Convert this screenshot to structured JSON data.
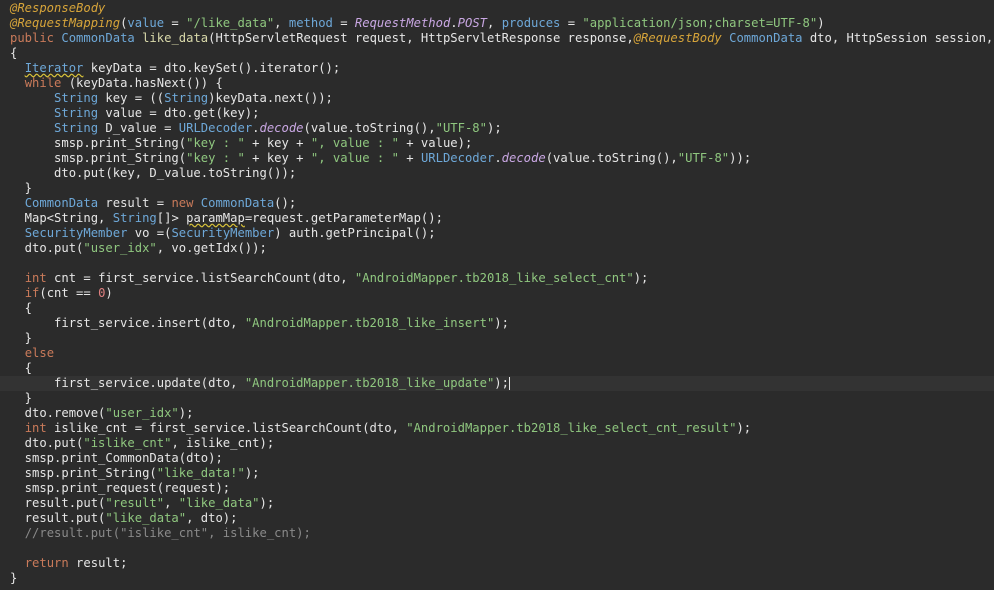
{
  "editor": {
    "lines": [
      [
        [
          "t-ann",
          "@ResponseBody"
        ]
      ],
      [
        [
          "t-ann",
          "@RequestMapping"
        ],
        [
          "t-text",
          "("
        ],
        [
          "t-type",
          "value"
        ],
        [
          "t-text",
          " = "
        ],
        [
          "t-str",
          "\"/like_data\""
        ],
        [
          "t-text",
          ", "
        ],
        [
          "t-type",
          "method"
        ],
        [
          "t-text",
          " = "
        ],
        [
          "t-italic",
          "RequestMethod"
        ],
        [
          "t-text",
          "."
        ],
        [
          "t-italic",
          "POST"
        ],
        [
          "t-text",
          ", "
        ],
        [
          "t-type",
          "produces"
        ],
        [
          "t-text",
          " = "
        ],
        [
          "t-str",
          "\"application/json;charset=UTF-8\""
        ],
        [
          "t-text",
          ")"
        ]
      ],
      [
        [
          "t-kw",
          "public"
        ],
        [
          "t-text",
          " "
        ],
        [
          "t-type",
          "CommonData"
        ],
        [
          "t-text",
          " "
        ],
        [
          "t-method",
          "like_data"
        ],
        [
          "t-text",
          "(HttpServletRequest request, HttpServletResponse response,"
        ],
        [
          "t-ann",
          "@RequestBody"
        ],
        [
          "t-text",
          " "
        ],
        [
          "t-type",
          "CommonData"
        ],
        [
          "t-text",
          " dto, HttpSession session, Model"
        ]
      ],
      [
        [
          "t-text",
          "{"
        ]
      ],
      [
        [
          "t-text",
          "  "
        ],
        [
          "t-type squiggle",
          "Iterator"
        ],
        [
          "t-text",
          " keyData = dto.keySet().iterator();"
        ]
      ],
      [
        [
          "t-text",
          "  "
        ],
        [
          "t-kw",
          "while"
        ],
        [
          "t-text",
          " (keyData.hasNext()) {"
        ]
      ],
      [
        [
          "t-text",
          "      "
        ],
        [
          "t-type",
          "String"
        ],
        [
          "t-text",
          " key = (("
        ],
        [
          "t-type",
          "String"
        ],
        [
          "t-text",
          ")keyData.next());"
        ]
      ],
      [
        [
          "t-text",
          "      "
        ],
        [
          "t-type",
          "String"
        ],
        [
          "t-text",
          " value = dto.get(key);"
        ]
      ],
      [
        [
          "t-text",
          "      "
        ],
        [
          "t-type",
          "String"
        ],
        [
          "t-text",
          " D_value = "
        ],
        [
          "t-type",
          "URLDecoder"
        ],
        [
          "t-text",
          "."
        ],
        [
          "t-italic",
          "decode"
        ],
        [
          "t-text",
          "(value.toString(),"
        ],
        [
          "t-str",
          "\"UTF-8\""
        ],
        [
          "t-text",
          ");"
        ]
      ],
      [
        [
          "t-text",
          "      smsp.print_String("
        ],
        [
          "t-str",
          "\"key : \""
        ],
        [
          "t-text",
          " + key + "
        ],
        [
          "t-str",
          "\", value : \""
        ],
        [
          "t-text",
          " + value);"
        ]
      ],
      [
        [
          "t-text",
          "      smsp.print_String("
        ],
        [
          "t-str",
          "\"key : \""
        ],
        [
          "t-text",
          " + key + "
        ],
        [
          "t-str",
          "\", value : \""
        ],
        [
          "t-text",
          " + "
        ],
        [
          "t-type",
          "URLDecoder"
        ],
        [
          "t-text",
          "."
        ],
        [
          "t-italic",
          "decode"
        ],
        [
          "t-text",
          "(value.toString(),"
        ],
        [
          "t-str",
          "\"UTF-8\""
        ],
        [
          "t-text",
          "));"
        ]
      ],
      [
        [
          "t-text",
          "      dto.put(key, D_value.toString());"
        ]
      ],
      [
        [
          "t-text",
          "  }"
        ]
      ],
      [
        [
          "t-text",
          "  "
        ],
        [
          "t-type",
          "CommonData"
        ],
        [
          "t-text",
          " result = "
        ],
        [
          "t-kw",
          "new"
        ],
        [
          "t-text",
          " "
        ],
        [
          "t-type",
          "CommonData"
        ],
        [
          "t-text",
          "();"
        ]
      ],
      [
        [
          "t-text",
          "  Map<String, "
        ],
        [
          "t-type",
          "String"
        ],
        [
          "t-text",
          "[]> "
        ],
        [
          "t-text squiggle",
          "paramMap"
        ],
        [
          "t-text",
          "=request.getParameterMap();"
        ]
      ],
      [
        [
          "t-text",
          "  "
        ],
        [
          "t-type",
          "SecurityMember"
        ],
        [
          "t-text",
          " vo =("
        ],
        [
          "t-type",
          "SecurityMember"
        ],
        [
          "t-text",
          ") auth.getPrincipal();"
        ]
      ],
      [
        [
          "t-text",
          "  dto.put("
        ],
        [
          "t-str",
          "\"user_idx\""
        ],
        [
          "t-text",
          ", vo.getIdx());"
        ]
      ],
      [
        [
          "t-text",
          ""
        ]
      ],
      [
        [
          "t-text",
          "  "
        ],
        [
          "t-kw",
          "int"
        ],
        [
          "t-text",
          " cnt = first_service.listSearchCount(dto, "
        ],
        [
          "t-str",
          "\"AndroidMapper.tb2018_like_select_cnt\""
        ],
        [
          "t-text",
          ");"
        ]
      ],
      [
        [
          "t-text",
          "  "
        ],
        [
          "t-kw",
          "if"
        ],
        [
          "t-text",
          "(cnt == "
        ],
        [
          "t-num",
          "0"
        ],
        [
          "t-text",
          ")"
        ]
      ],
      [
        [
          "t-text",
          "  {"
        ]
      ],
      [
        [
          "t-text",
          "      first_service.insert(dto, "
        ],
        [
          "t-str",
          "\"AndroidMapper.tb2018_like_insert\""
        ],
        [
          "t-text",
          ");"
        ]
      ],
      [
        [
          "t-text",
          "  }"
        ]
      ],
      [
        [
          "t-text",
          "  "
        ],
        [
          "t-kw",
          "else"
        ]
      ],
      [
        [
          "t-text",
          "  {"
        ]
      ],
      [
        [
          "t-text",
          "      first_service.update(dto, "
        ],
        [
          "t-str",
          "\"AndroidMapper.tb2018_like_update\""
        ],
        [
          "t-text",
          ");"
        ]
      ],
      [
        [
          "t-text",
          "  }"
        ]
      ],
      [
        [
          "t-text",
          "  dto.remove("
        ],
        [
          "t-str",
          "\"user_idx\""
        ],
        [
          "t-text",
          ");"
        ]
      ],
      [
        [
          "t-text",
          "  "
        ],
        [
          "t-kw",
          "int"
        ],
        [
          "t-text",
          " islike_cnt = first_service.listSearchCount(dto, "
        ],
        [
          "t-str",
          "\"AndroidMapper.tb2018_like_select_cnt_result\""
        ],
        [
          "t-text",
          ");"
        ]
      ],
      [
        [
          "t-text",
          "  dto.put("
        ],
        [
          "t-str",
          "\"islike_cnt\""
        ],
        [
          "t-text",
          ", islike_cnt);"
        ]
      ],
      [
        [
          "t-text",
          "  smsp.print_CommonData(dto);"
        ]
      ],
      [
        [
          "t-text",
          "  smsp.print_String("
        ],
        [
          "t-str",
          "\"like_data!\""
        ],
        [
          "t-text",
          ");"
        ]
      ],
      [
        [
          "t-text",
          "  smsp.print_request(request);"
        ]
      ],
      [
        [
          "t-text",
          "  result.put("
        ],
        [
          "t-str",
          "\"result\""
        ],
        [
          "t-text",
          ", "
        ],
        [
          "t-str",
          "\"like_data\""
        ],
        [
          "t-text",
          ");"
        ]
      ],
      [
        [
          "t-text",
          "  result.put("
        ],
        [
          "t-str",
          "\"like_data\""
        ],
        [
          "t-text",
          ", dto);"
        ]
      ],
      [
        [
          "t-text",
          "  "
        ],
        [
          "t-cmt",
          "//result.put(\"islike_cnt\", islike_cnt);"
        ]
      ],
      [
        [
          "t-text",
          ""
        ]
      ],
      [
        [
          "t-text",
          "  "
        ],
        [
          "t-kw",
          "return"
        ],
        [
          "t-text",
          " result;"
        ]
      ],
      [
        [
          "t-text",
          "}"
        ]
      ]
    ],
    "current_line": 25
  }
}
